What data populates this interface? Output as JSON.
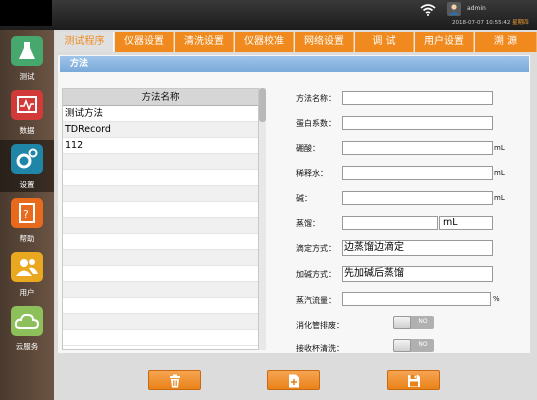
{
  "status": {
    "user_name": "admin",
    "datetime": "2018-07-07 10:55:42",
    "weekday": "星期四"
  },
  "sidebar": {
    "items": [
      {
        "label": "测试",
        "color": "#47a86e"
      },
      {
        "label": "数据",
        "color": "#d23a3a"
      },
      {
        "label": "设置",
        "color": "#1f86a8",
        "active": true
      },
      {
        "label": "帮助",
        "color": "#e86a1c"
      },
      {
        "label": "用户",
        "color": "#e9a820"
      },
      {
        "label": "云服务",
        "color": "#8dc05a"
      }
    ]
  },
  "tabs": [
    "测试程序",
    "仪器设置",
    "清洗设置",
    "仪器校准",
    "网络设置",
    "调  试",
    "用户设置",
    "溯  源"
  ],
  "panel": {
    "title": "方法"
  },
  "list": {
    "header": "方法名称",
    "rows": [
      "测试方法",
      "TDRecord",
      "112"
    ]
  },
  "form": {
    "method_name": {
      "label": "方法名称：",
      "value": ""
    },
    "protein_factor": {
      "label": "蛋白系数：",
      "value": ""
    },
    "boric_acid": {
      "label": "硼酸：",
      "value": "",
      "unit": "mL"
    },
    "dilution_water": {
      "label": "稀释水：",
      "value": "",
      "unit": "mL"
    },
    "alkali": {
      "label": "碱：",
      "value": "",
      "unit": "mL"
    },
    "distill": {
      "label": "蒸馏：",
      "value": "",
      "unit": "mL"
    },
    "titration_mode": {
      "label": "滴定方式：",
      "value": "边蒸馏边滴定"
    },
    "alkali_mode": {
      "label": "加碱方式：",
      "value": "先加碱后蒸馏"
    },
    "steam_flow": {
      "label": "蒸汽流量：",
      "value": "",
      "unit": "%"
    },
    "digest_tube_drain": {
      "label": "消化管排废：",
      "state": "NO"
    },
    "receiver_cup_clean": {
      "label": "接收杯清洗：",
      "state": "NO"
    }
  },
  "colors": {
    "accent": "#f08a1e",
    "title_bar": "#7aaad8"
  }
}
